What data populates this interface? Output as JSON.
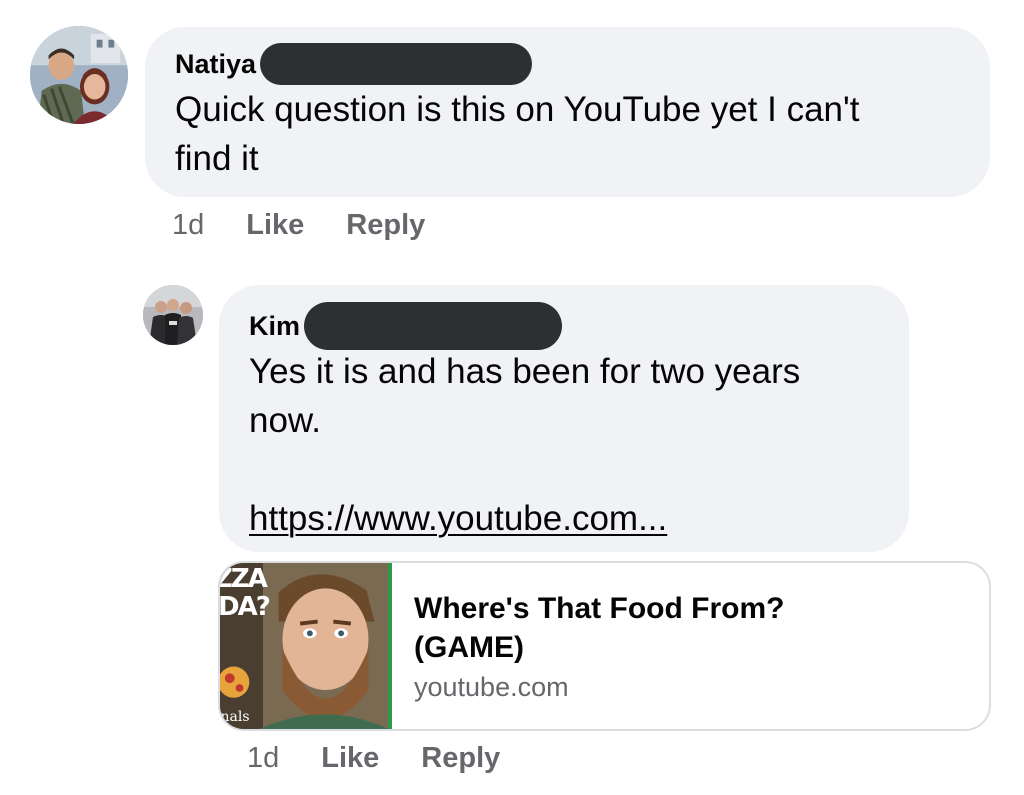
{
  "comments": [
    {
      "author": "Natiya",
      "lines": [
        "Quick question is this on YouTube yet I can't",
        "find it"
      ],
      "time": "1d",
      "like_label": "Like",
      "reply_label": "Reply"
    },
    {
      "author": "Kim",
      "lines": [
        "Yes it is and has been for two years",
        "now."
      ],
      "link_text": "https://www.youtube.com...",
      "time": "1d",
      "like_label": "Like",
      "reply_label": "Reply",
      "preview": {
        "title_lines": [
          "Where's That Food From?",
          "(GAME)"
        ],
        "domain": "youtube.com",
        "thumb_text_1": "ZZA",
        "thumb_text_2": "DA?",
        "thumb_text_3": "inals"
      }
    }
  ],
  "colors": {
    "bubble": "#f0f2f5",
    "meta_text": "#65676b",
    "redaction": "#2d2f31",
    "thumb_border": "#2c9a48"
  },
  "icons": [
    "avatar-photo",
    "video-thumbnail"
  ]
}
